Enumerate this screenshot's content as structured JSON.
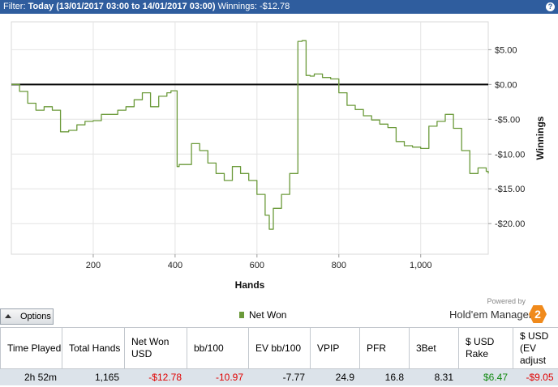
{
  "header": {
    "filter_label": "Filter:",
    "filter_text": "Today (13/01/2017 03:00 to 14/01/2017 03:00)",
    "winnings_label": "Winnings:",
    "winnings_value": "-$12.78",
    "help_label": "?"
  },
  "colors": {
    "title_bar": "#2f5d9e",
    "series_line": "#6b9a3a",
    "zero_line": "#000000",
    "negative": "#e00000",
    "positive": "#138a13",
    "brand_logo": "#f08a1c"
  },
  "chart_data": {
    "type": "line",
    "title": "",
    "xlabel": "Hands",
    "ylabel": "Winnings",
    "xlim": [
      0,
      1165
    ],
    "ylim": [
      -24.4,
      9
    ],
    "x_ticks": [
      {
        "value": 200,
        "label": "200"
      },
      {
        "value": 400,
        "label": "400"
      },
      {
        "value": 600,
        "label": "600"
      },
      {
        "value": 800,
        "label": "800"
      },
      {
        "value": 1000,
        "label": "1,000"
      }
    ],
    "y_ticks": [
      {
        "value": 5,
        "label": "$5.00"
      },
      {
        "value": 0,
        "label": "$0.00"
      },
      {
        "value": -5,
        "label": "-$5.00"
      },
      {
        "value": -10,
        "label": "-$10.00"
      },
      {
        "value": -15,
        "label": "-$15.00"
      },
      {
        "value": -20,
        "label": "-$20.00"
      }
    ],
    "grid": true,
    "y_axis_side": "right",
    "zero_line": true,
    "legend_position": "bottom",
    "series": [
      {
        "name": "Net Won",
        "x": [
          0,
          20,
          40,
          60,
          80,
          100,
          120,
          140,
          160,
          180,
          200,
          220,
          240,
          260,
          280,
          300,
          320,
          340,
          360,
          380,
          390,
          400,
          405,
          410,
          420,
          440,
          460,
          480,
          500,
          520,
          540,
          560,
          580,
          600,
          620,
          630,
          640,
          660,
          680,
          690,
          700,
          710,
          720,
          730,
          740,
          760,
          780,
          800,
          820,
          840,
          860,
          880,
          900,
          920,
          940,
          960,
          980,
          1000,
          1020,
          1040,
          1060,
          1080,
          1100,
          1120,
          1140,
          1160,
          1165
        ],
        "y": [
          0,
          -1,
          -2.7,
          -3.7,
          -3.2,
          -3.7,
          -6.8,
          -6.6,
          -5.8,
          -5.3,
          -5.2,
          -4.3,
          -4.3,
          -3.7,
          -3.2,
          -2.2,
          -1.2,
          -3.2,
          -1.7,
          -1.2,
          -0.9,
          -0.9,
          -11.8,
          -11.5,
          -11.5,
          -8.5,
          -9.5,
          -11.3,
          -12.8,
          -13.8,
          -11.8,
          -12.8,
          -13.8,
          -15.8,
          -18.8,
          -20.8,
          -17.8,
          -15.8,
          -12.8,
          -12.8,
          6.2,
          6.3,
          1.3,
          1.2,
          1.5,
          1.0,
          0.8,
          -1.2,
          -3.0,
          -3.6,
          -4.5,
          -5.1,
          -5.7,
          -6.2,
          -8.2,
          -8.8,
          -9.0,
          -9.2,
          -6.0,
          -5.3,
          -4.3,
          -6.3,
          -9.5,
          -12.8,
          -12.0,
          -12.5,
          -12.78
        ]
      }
    ]
  },
  "footer": {
    "options_label": "Options",
    "legend_label": "Net Won",
    "powered_by": "Powered by",
    "brand_name": "Hold'em Manager",
    "brand_logo_text": "2"
  },
  "stats": {
    "columns": [
      {
        "header": "Time Played",
        "value": "2h 52m",
        "tone": "neutral"
      },
      {
        "header": "Total Hands",
        "value": "1,165",
        "tone": "neutral"
      },
      {
        "header": "Net Won USD",
        "value": "-$12.78",
        "tone": "negative"
      },
      {
        "header": "bb/100",
        "value": "-10.97",
        "tone": "negative"
      },
      {
        "header": "EV bb/100",
        "value": "-7.77",
        "tone": "neutral"
      },
      {
        "header": "VPIP",
        "value": "24.9",
        "tone": "neutral"
      },
      {
        "header": "PFR",
        "value": "16.8",
        "tone": "neutral"
      },
      {
        "header": "3Bet",
        "value": "8.31",
        "tone": "neutral"
      },
      {
        "header": "$ USD Rake",
        "value": "$6.47",
        "tone": "positive"
      },
      {
        "header": "$ USD (EV adjust",
        "value": "-$9.05",
        "tone": "negative"
      }
    ]
  }
}
